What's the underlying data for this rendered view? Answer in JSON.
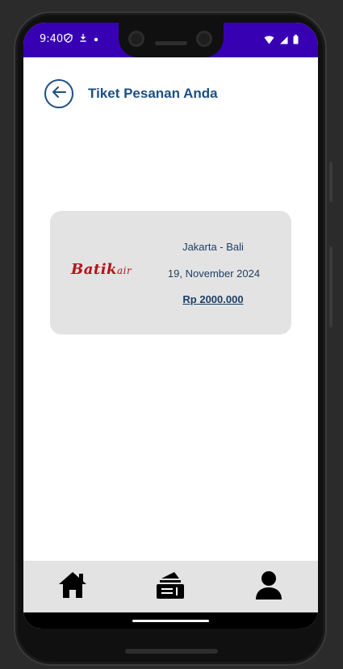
{
  "status_bar": {
    "time": "9:40",
    "left_icons": [
      "shield-icon",
      "download-icon",
      "dot-icon"
    ],
    "right_icons": [
      "wifi-icon",
      "signal-icon",
      "battery-icon"
    ],
    "background_color": "#3700b3"
  },
  "header": {
    "title": "Tiket Pesanan Anda",
    "back_icon": "arrow-left-icon",
    "accent_color": "#1d4f82"
  },
  "ticket": {
    "airline_logo_text": "Batik",
    "airline_logo_suffix": "air",
    "route": "Jakarta - Bali",
    "date": "19, November 2024",
    "price": "Rp 2000.000"
  },
  "bottom_nav": {
    "items": [
      {
        "name": "home",
        "icon": "home-icon"
      },
      {
        "name": "tickets",
        "icon": "ticket-stack-icon"
      },
      {
        "name": "profile",
        "icon": "user-icon"
      }
    ]
  }
}
